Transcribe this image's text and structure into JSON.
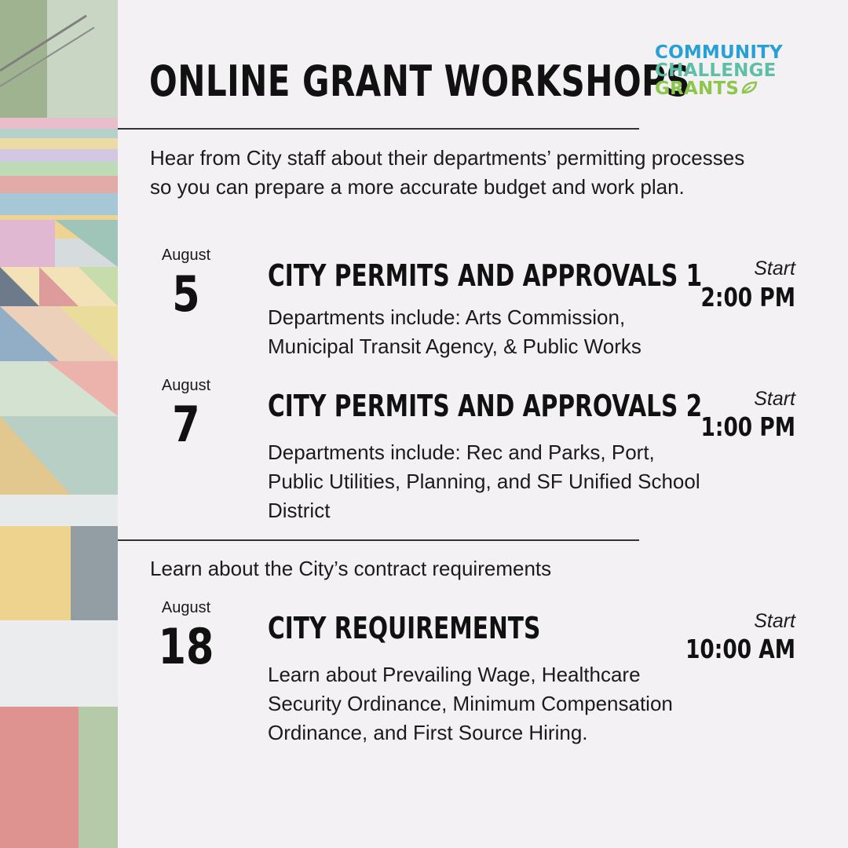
{
  "header": {
    "title": "ONLINE GRANT WORKSHOPS",
    "logo": {
      "line1": "COMMUNITY",
      "line2": "CHALLENGE",
      "line3": "GRANTS"
    }
  },
  "intro_text": "Hear from City staff about their departments’ permitting processes so you can prepare a more accurate budget and work plan.",
  "section2_intro": "Learn about the City’s contract requirements",
  "events": [
    {
      "month": "August",
      "day": "5",
      "title": "CITY PERMITS AND APPROVALS 1",
      "description": "Departments include: Arts Commission, Municipal Transit Agency,  & Public Works",
      "start_label": "Start",
      "start_time": "2:00 PM"
    },
    {
      "month": "August",
      "day": "7",
      "title": "CITY PERMITS AND APPROVALS 2",
      "description": "Departments include: Rec and Parks, Port, Public Utilities, Planning, and SF Unified School District",
      "start_label": "Start",
      "start_time": "1:00 PM"
    },
    {
      "month": "August",
      "day": "18",
      "title": "CITY REQUIREMENTS",
      "description": "Learn about Prevailing Wage, Healthcare Security Ordinance, Minimum Compensation Ordinance, and First Source Hiring.",
      "start_label": "Start",
      "start_time": "10:00 AM"
    }
  ],
  "colors": {
    "background": "#f3f1f4",
    "logo_blue": "#27a0d8",
    "logo_teal": "#5dbfa7",
    "logo_green": "#8cc64a"
  }
}
